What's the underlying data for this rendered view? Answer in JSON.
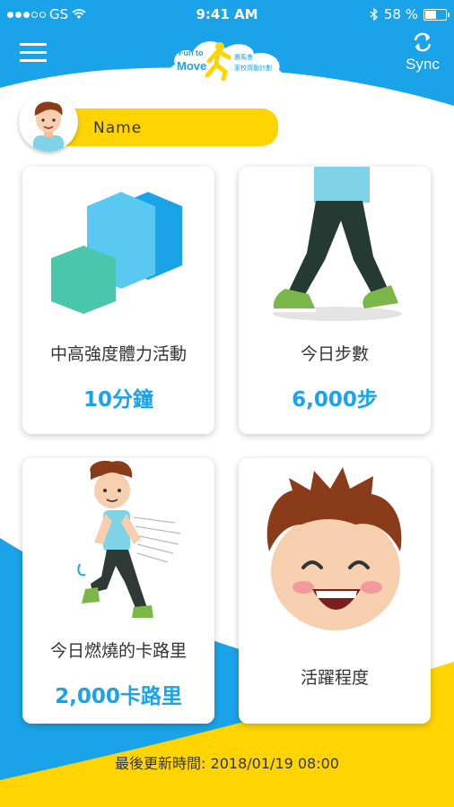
{
  "status_bar": {
    "carrier": "GS",
    "time": "9:41 AM",
    "battery": "58 %"
  },
  "header": {
    "menu_icon": "hamburger-menu-icon",
    "logo_text_1": "Fun to",
    "logo_text_2": "Move",
    "logo_org": "賽馬會",
    "logo_program": "家校齊動計劃",
    "sync_label": "Sync",
    "sync_icon": "refresh-icon"
  },
  "profile": {
    "name": "Name"
  },
  "cards": [
    {
      "label": "中高強度體力活動",
      "value": "10分鐘",
      "icon": "hexagon-blocks-icon"
    },
    {
      "label": "今日步數",
      "value": "6,000步",
      "icon": "walking-legs-icon"
    },
    {
      "label": "今日燃燒的卡路里",
      "value": "2,000卡路里",
      "icon": "running-boy-icon"
    },
    {
      "label": "活躍程度",
      "value": "",
      "icon": "happy-face-icon"
    }
  ],
  "footer": {
    "last_updated": "最後更新時間: 2018/01/19 08:00"
  },
  "colors": {
    "primary_blue": "#1aa3e8",
    "accent_yellow": "#ffd400"
  }
}
